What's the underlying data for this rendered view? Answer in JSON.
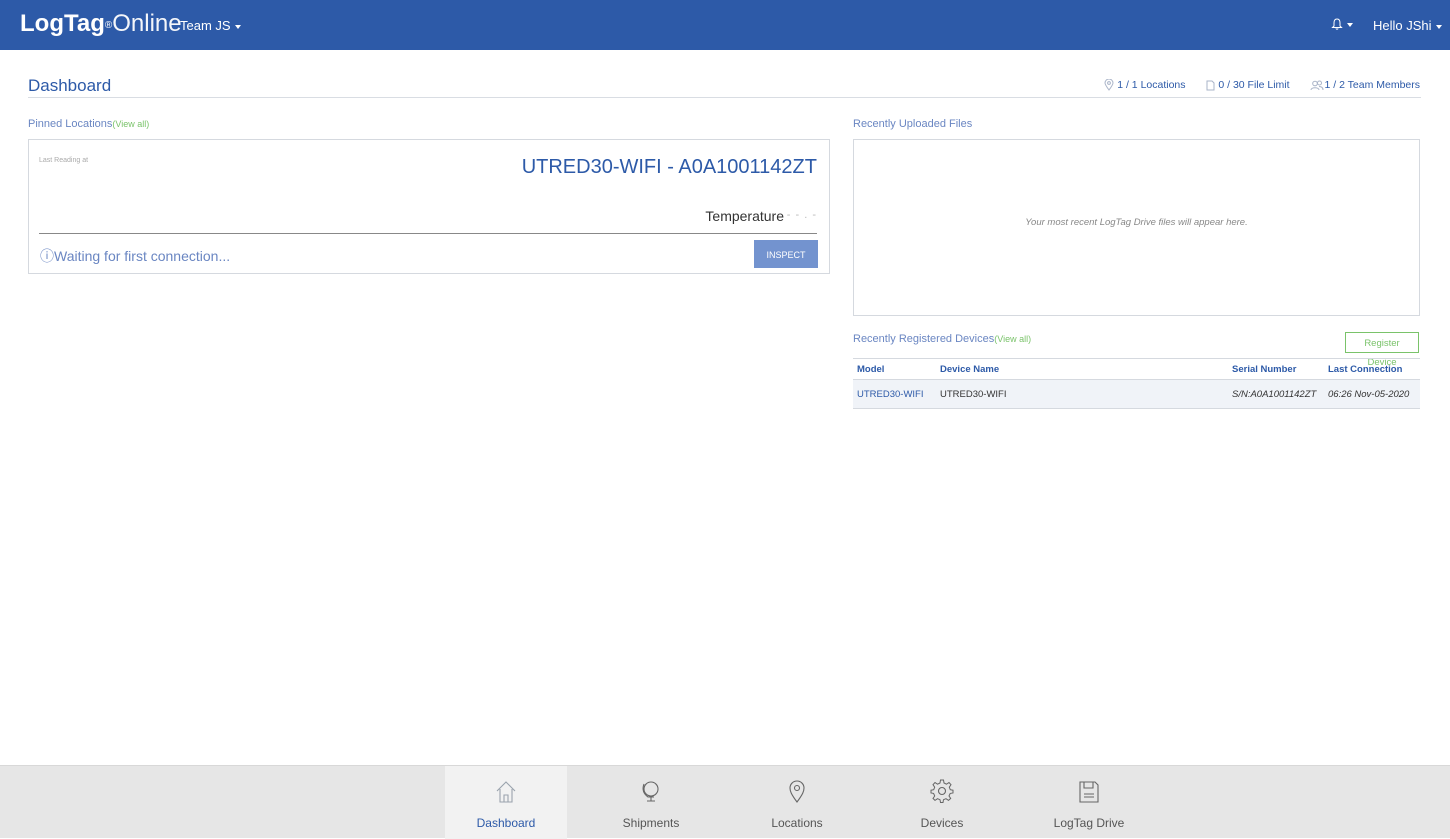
{
  "header": {
    "logo_bold": "LogTag",
    "logo_reg": "®",
    "logo_light": "Online",
    "team_label": "Team JS",
    "bell_icon": "bell-icon",
    "user_label": "Hello JShi"
  },
  "page": {
    "title": "Dashboard",
    "stats": {
      "locations": "1 / 1 Locations",
      "files": "0 / 30 File Limit",
      "members": "1 / 2 Team Members"
    }
  },
  "pinned": {
    "label": "Pinned Locations",
    "view_all": "(View all)",
    "card": {
      "last_reading": "Last Reading at",
      "device_title": "UTRED30-WIFI - A0A1001142ZT",
      "temperature_label": "Temperature",
      "temperature_value": "- - . -",
      "status": "ⓘWaiting for first connection...",
      "inspect_label": "INSPECT"
    }
  },
  "files": {
    "label": "Recently Uploaded Files",
    "empty_message": "Your most recent LogTag Drive files will appear here."
  },
  "devices": {
    "label": "Recently Registered Devices",
    "view_all": "(View all)",
    "register_label": "Register Device",
    "columns": [
      "Model",
      "Device Name",
      "Serial Number",
      "Last Connection"
    ],
    "rows": [
      {
        "model": "UTRED30-WIFI",
        "name": "UTRED30-WIFI",
        "serial": "S/N:A0A1001142ZT",
        "last": "06:26 Nov-05-2020"
      }
    ]
  },
  "bottom_nav": [
    {
      "label": "Dashboard",
      "icon": "home-icon"
    },
    {
      "label": "Shipments",
      "icon": "globe-icon"
    },
    {
      "label": "Locations",
      "icon": "location-pin-icon"
    },
    {
      "label": "Devices",
      "icon": "gear-icon"
    },
    {
      "label": "LogTag Drive",
      "icon": "floppy-disk-icon"
    }
  ],
  "colors": {
    "brand": "#2d5aa8",
    "accent_green": "#7ac36a",
    "button": "#7393cf"
  }
}
